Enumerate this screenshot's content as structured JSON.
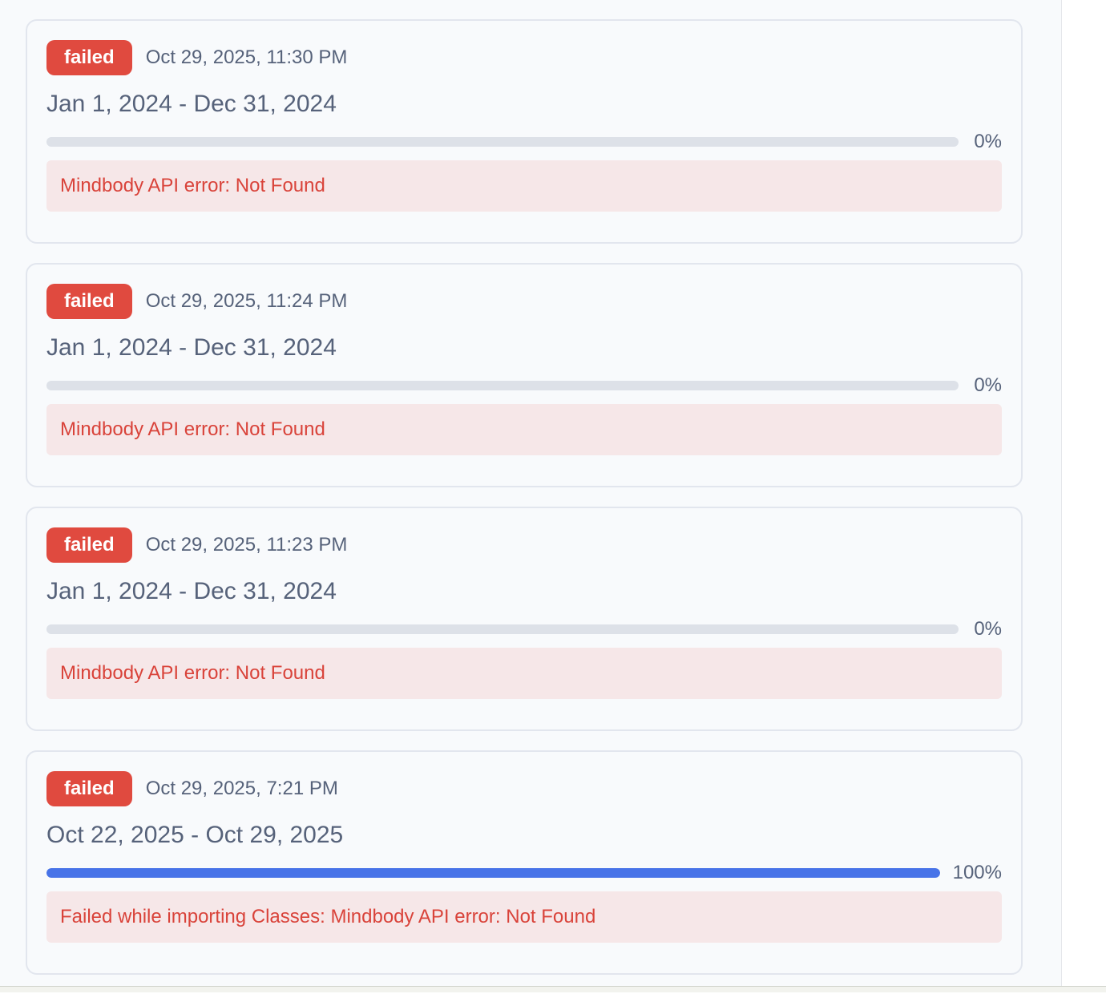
{
  "colors": {
    "status_failed": "#e04a3f",
    "progress_fill": "#4773e8",
    "progress_track": "#dde1e8",
    "error_background": "#f6e7e8",
    "error_text": "#d9433a"
  },
  "jobs": [
    {
      "status": "failed",
      "timestamp": "Oct 29, 2025, 11:30 PM",
      "date_range": "Jan 1, 2024 - Dec 31, 2024",
      "progress": 0,
      "progress_label": "0%",
      "error": "Mindbody API error: Not Found"
    },
    {
      "status": "failed",
      "timestamp": "Oct 29, 2025, 11:24 PM",
      "date_range": "Jan 1, 2024 - Dec 31, 2024",
      "progress": 0,
      "progress_label": "0%",
      "error": "Mindbody API error: Not Found"
    },
    {
      "status": "failed",
      "timestamp": "Oct 29, 2025, 11:23 PM",
      "date_range": "Jan 1, 2024 - Dec 31, 2024",
      "progress": 0,
      "progress_label": "0%",
      "error": "Mindbody API error: Not Found"
    },
    {
      "status": "failed",
      "timestamp": "Oct 29, 2025, 7:21 PM",
      "date_range": "Oct 22, 2025 - Oct 29, 2025",
      "progress": 100,
      "progress_label": "100%",
      "error": "Failed while importing Classes: Mindbody API error: Not Found"
    }
  ]
}
